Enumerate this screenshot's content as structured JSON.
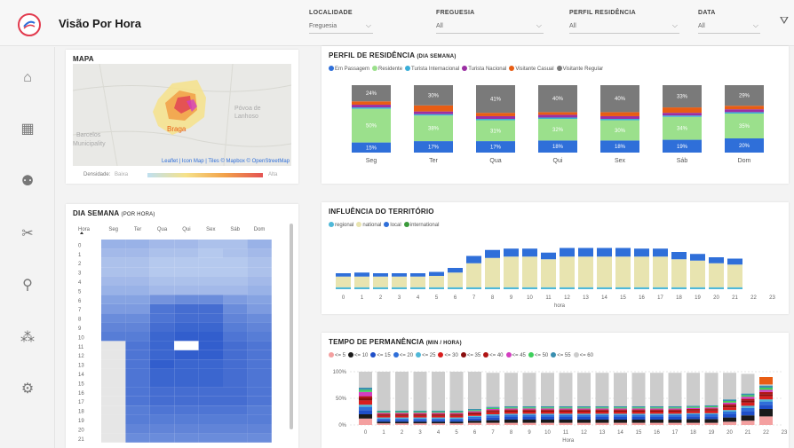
{
  "header": {
    "title": "Visão Por Hora",
    "filters": [
      {
        "label": "LOCALIDADE",
        "value": "Freguesia"
      },
      {
        "label": "FREGUESIA",
        "value": "All"
      },
      {
        "label": "PERFIL RESIDÊNCIA",
        "value": "All"
      },
      {
        "label": "DATA",
        "value": "All"
      }
    ]
  },
  "sidebar": {
    "items": [
      {
        "icon": "home-icon",
        "glyph": "⌂"
      },
      {
        "icon": "grid-icon",
        "glyph": "▦"
      },
      {
        "icon": "people-icon",
        "glyph": "⚉"
      },
      {
        "icon": "scissors-icon",
        "glyph": "✂"
      },
      {
        "icon": "location-pin-icon",
        "glyph": "⚲"
      },
      {
        "icon": "network-icon",
        "glyph": "⁂"
      },
      {
        "icon": "settings-icon",
        "glyph": "⚙"
      }
    ]
  },
  "map_card": {
    "title": "MAPA",
    "places": [
      "Póvoa de",
      "Lanhoso",
      "Barcelos",
      "Municipality",
      "Braga"
    ],
    "attribution": "Leaflet | Icon Map | Tiles © Mapbox © OpenStreetMap",
    "density_label": "Densidade:",
    "density_low": "Baixa",
    "density_high": "Alta"
  },
  "heatmap_card": {
    "title": "DIA SEMANA",
    "title_sub": "(POR HORA)",
    "hour_header": "Hora",
    "days": [
      "Seg",
      "Ter",
      "Qua",
      "Qui",
      "Sex",
      "Sáb",
      "Dom"
    ],
    "hours": [
      "0",
      "1",
      "2",
      "3",
      "4",
      "5",
      "6",
      "7",
      "8",
      "9",
      "10",
      "11",
      "12",
      "13",
      "14",
      "15",
      "16",
      "17",
      "18",
      "19",
      "20",
      "21"
    ],
    "intensity": [
      [
        0.35,
        0.35,
        0.3,
        0.3,
        0.25,
        0.25,
        0.35
      ],
      [
        0.3,
        0.3,
        0.25,
        0.25,
        0.2,
        0.25,
        0.3
      ],
      [
        0.25,
        0.25,
        0.2,
        0.2,
        0.2,
        0.2,
        0.25
      ],
      [
        0.25,
        0.25,
        0.2,
        0.2,
        0.2,
        0.2,
        0.25
      ],
      [
        0.3,
        0.3,
        0.25,
        0.25,
        0.25,
        0.25,
        0.3
      ],
      [
        0.35,
        0.35,
        0.3,
        0.3,
        0.3,
        0.3,
        0.35
      ],
      [
        0.45,
        0.45,
        0.55,
        0.6,
        0.6,
        0.5,
        0.45
      ],
      [
        0.5,
        0.5,
        0.75,
        0.8,
        0.8,
        0.6,
        0.5
      ],
      [
        0.6,
        0.6,
        0.75,
        0.8,
        0.8,
        0.65,
        0.6
      ],
      [
        0.65,
        0.65,
        0.8,
        0.85,
        0.85,
        0.7,
        0.65
      ],
      [
        0.7,
        0.7,
        0.85,
        0.9,
        0.9,
        0.75,
        0.7
      ],
      [
        null,
        0.75,
        0.85,
        0.0,
        0.9,
        0.8,
        0.75
      ],
      [
        null,
        0.75,
        0.85,
        0.9,
        0.9,
        0.8,
        0.75
      ],
      [
        null,
        0.75,
        0.9,
        0.85,
        0.85,
        0.8,
        0.75
      ],
      [
        null,
        0.75,
        0.85,
        0.85,
        0.85,
        0.8,
        0.75
      ],
      [
        null,
        0.75,
        0.85,
        0.85,
        0.85,
        0.8,
        0.75
      ],
      [
        null,
        0.75,
        0.8,
        0.8,
        0.8,
        0.8,
        0.75
      ],
      [
        null,
        0.75,
        0.8,
        0.8,
        0.8,
        0.8,
        0.75
      ],
      [
        null,
        0.7,
        0.75,
        0.75,
        0.75,
        0.75,
        0.7
      ],
      [
        null,
        0.7,
        0.7,
        0.7,
        0.7,
        0.7,
        0.7
      ],
      [
        null,
        0.65,
        0.65,
        0.65,
        0.65,
        0.65,
        0.65
      ],
      [
        null,
        0.6,
        0.6,
        0.6,
        0.6,
        0.6,
        0.6
      ]
    ]
  },
  "perfil_card": {
    "title": "PERFIL DE RESIDÊNCIA",
    "title_sub": "(DIA SEMANA)"
  },
  "influencia_card": {
    "title": "INFLUÊNCIA DO TERRITÓRIO"
  },
  "permanencia_card": {
    "title": "TEMPO DE PERMANÊNCIA",
    "title_sub": "(MIN / HORA)"
  },
  "colors": {
    "accent_red": "#e23b4e",
    "heat_low": "#dbe7f7",
    "heat_high": "#1f4fc8"
  },
  "chart_data": [
    {
      "id": "perfil",
      "type": "bar",
      "stacked": true,
      "categories": [
        "Seg",
        "Ter",
        "Qua",
        "Qui",
        "Sex",
        "Sáb",
        "Dom"
      ],
      "series": [
        {
          "name": "Em Passagem",
          "color": "#2f6fd9",
          "values": [
            15,
            17,
            17,
            18,
            18,
            19,
            20
          ]
        },
        {
          "name": "Residente",
          "color": "#9be08c",
          "values": [
            50,
            38,
            31,
            32,
            30,
            34,
            35
          ]
        },
        {
          "name": "Turista Internacional",
          "color": "#3aaed8",
          "values": [
            2,
            2,
            2,
            2,
            2,
            2,
            2
          ]
        },
        {
          "name": "Turista Nacional",
          "color": "#9b2fa3",
          "values": [
            4,
            4,
            4,
            4,
            4,
            4,
            4
          ]
        },
        {
          "name": "Visitante Casual",
          "color": "#e85d14",
          "values": [
            5,
            9,
            5,
            4,
            6,
            8,
            5
          ]
        },
        {
          "name": "Visitante Regular",
          "color": "#7a7a7a",
          "values": [
            24,
            30,
            41,
            40,
            40,
            33,
            29
          ]
        }
      ],
      "labels": {
        "Em Passagem": [
          "15%",
          "17%",
          "17%",
          "18%",
          "18%",
          "19%",
          "20%"
        ],
        "Residente": [
          "50%",
          "38%",
          "31%",
          "32%",
          "30%",
          "34%",
          "35%"
        ],
        "Visitante Regular": [
          "24%",
          "30%",
          "41%",
          "40%",
          "40%",
          "33%",
          "29%"
        ]
      }
    },
    {
      "id": "influencia",
      "type": "bar",
      "stacked": true,
      "x": [
        "0",
        "1",
        "2",
        "3",
        "4",
        "5",
        "6",
        "7",
        "8",
        "9",
        "10",
        "11",
        "12",
        "13",
        "14",
        "15",
        "16",
        "17",
        "18",
        "19",
        "20",
        "21",
        "22",
        "23"
      ],
      "xlabel": "hora",
      "series": [
        {
          "name": "regional",
          "color": "#4fb8d8",
          "values": [
            3,
            3,
            3,
            3,
            3,
            3,
            3,
            3,
            3,
            3,
            3,
            3,
            3,
            3,
            3,
            3,
            3,
            3,
            3,
            3,
            3,
            3,
            0,
            0
          ]
        },
        {
          "name": "national",
          "color": "#e8e4b0",
          "values": [
            16,
            16,
            16,
            16,
            16,
            17,
            22,
            36,
            44,
            46,
            46,
            42,
            46,
            46,
            46,
            46,
            46,
            46,
            42,
            40,
            36,
            34,
            0,
            0
          ]
        },
        {
          "name": "local",
          "color": "#2f6fd9",
          "values": [
            5,
            6,
            5,
            5,
            5,
            6,
            7,
            11,
            12,
            12,
            12,
            10,
            13,
            13,
            13,
            13,
            12,
            12,
            11,
            10,
            9,
            9,
            0,
            0
          ]
        },
        {
          "name": "international",
          "color": "#3a9a3a",
          "values": [
            0,
            0,
            0,
            0,
            0,
            0,
            0,
            0,
            0,
            0,
            0,
            0,
            0,
            0,
            0,
            0,
            0,
            0,
            0,
            0,
            0,
            0,
            0,
            0
          ]
        }
      ]
    },
    {
      "id": "permanencia",
      "type": "bar",
      "stacked": true,
      "x": [
        "0",
        "1",
        "2",
        "3",
        "4",
        "5",
        "6",
        "7",
        "8",
        "9",
        "10",
        "11",
        "12",
        "13",
        "14",
        "15",
        "16",
        "17",
        "18",
        "19",
        "20",
        "21",
        "22",
        "23"
      ],
      "xlabel": "Hora",
      "y_ticks": [
        "100%",
        "50%",
        "0%"
      ],
      "ylim": [
        0,
        100
      ],
      "series": [
        {
          "name": "<= 5",
          "color": "#f4a0a0",
          "values": [
            12,
            3,
            3,
            3,
            3,
            3,
            4,
            4,
            4,
            4,
            4,
            4,
            4,
            4,
            4,
            4,
            4,
            4,
            4,
            4,
            6,
            8,
            16,
            0
          ]
        },
        {
          "name": "<= 10",
          "color": "#1a1a1a",
          "values": [
            8,
            3,
            3,
            3,
            3,
            3,
            4,
            5,
            6,
            6,
            6,
            6,
            6,
            6,
            6,
            6,
            6,
            6,
            7,
            7,
            8,
            10,
            14,
            0
          ]
        },
        {
          "name": "<= 15",
          "color": "#1f4fc8",
          "values": [
            8,
            3,
            3,
            3,
            3,
            3,
            4,
            5,
            5,
            5,
            5,
            5,
            5,
            5,
            5,
            5,
            5,
            5,
            5,
            5,
            6,
            8,
            8,
            0
          ]
        },
        {
          "name": "<= 20",
          "color": "#2f6fd9",
          "values": [
            6,
            3,
            3,
            3,
            3,
            3,
            3,
            4,
            4,
            4,
            4,
            4,
            4,
            4,
            4,
            4,
            4,
            4,
            4,
            4,
            5,
            6,
            6,
            0
          ]
        },
        {
          "name": "<= 25",
          "color": "#4fb8d8",
          "values": [
            4,
            2,
            2,
            2,
            2,
            2,
            2,
            2,
            2,
            2,
            2,
            2,
            2,
            2,
            2,
            2,
            2,
            2,
            2,
            2,
            3,
            4,
            4,
            0
          ]
        },
        {
          "name": "<= 30",
          "color": "#d81e1e",
          "values": [
            8,
            3,
            3,
            3,
            3,
            3,
            3,
            4,
            4,
            4,
            4,
            4,
            4,
            4,
            4,
            4,
            4,
            4,
            4,
            5,
            5,
            6,
            6,
            0
          ]
        },
        {
          "name": "<= 35",
          "color": "#8a0e0e",
          "values": [
            4,
            2,
            2,
            2,
            2,
            2,
            2,
            2,
            2,
            2,
            2,
            2,
            2,
            2,
            2,
            2,
            2,
            2,
            2,
            2,
            3,
            4,
            4,
            0
          ]
        },
        {
          "name": "<= 40",
          "color": "#b01515",
          "values": [
            4,
            2,
            2,
            2,
            2,
            2,
            2,
            2,
            2,
            2,
            2,
            2,
            2,
            2,
            2,
            2,
            2,
            2,
            2,
            2,
            3,
            3,
            4,
            0
          ]
        },
        {
          "name": "<= 45",
          "color": "#d33ec0",
          "values": [
            8,
            2,
            2,
            2,
            2,
            2,
            2,
            2,
            2,
            2,
            2,
            2,
            2,
            2,
            2,
            2,
            2,
            2,
            2,
            2,
            3,
            4,
            4,
            0
          ]
        },
        {
          "name": "<= 50",
          "color": "#3fcf5c",
          "values": [
            4,
            2,
            2,
            2,
            2,
            2,
            2,
            2,
            2,
            2,
            2,
            2,
            2,
            2,
            2,
            2,
            2,
            2,
            2,
            2,
            3,
            3,
            4,
            0
          ]
        },
        {
          "name": "<= 55",
          "color": "#3a8fb0",
          "values": [
            4,
            2,
            2,
            2,
            2,
            2,
            2,
            2,
            2,
            2,
            2,
            2,
            2,
            2,
            2,
            2,
            2,
            2,
            2,
            2,
            3,
            3,
            4,
            0
          ]
        },
        {
          "name": "<= 60",
          "color": "#cccccc",
          "values": [
            30,
            73,
            73,
            73,
            73,
            73,
            70,
            64,
            63,
            63,
            63,
            63,
            63,
            63,
            63,
            63,
            63,
            63,
            62,
            61,
            50,
            37,
            2,
            0
          ]
        }
      ],
      "extra_top": {
        "name": "<= 60 overflow",
        "color": "#e85d14",
        "hour": "22",
        "value": 14
      }
    }
  ]
}
